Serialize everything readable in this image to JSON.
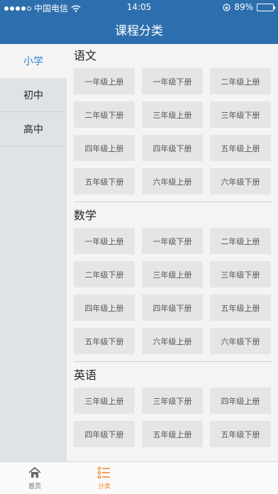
{
  "status_bar": {
    "carrier": "中国电信",
    "time": "14:05",
    "battery": "89%",
    "battery_level": 0.89
  },
  "header": {
    "title": "课程分类"
  },
  "sidebar": {
    "items": [
      {
        "label": "小学",
        "active": true
      },
      {
        "label": "初中",
        "active": false
      },
      {
        "label": "高中",
        "active": false
      }
    ]
  },
  "sections": [
    {
      "title": "语文",
      "items": [
        "一年级上册",
        "一年级下册",
        "二年级上册",
        "二年级下册",
        "三年级上册",
        "三年级下册",
        "四年级上册",
        "四年级下册",
        "五年级上册",
        "五年级下册",
        "六年级上册",
        "六年级下册"
      ]
    },
    {
      "title": "数学",
      "items": [
        "一年级上册",
        "一年级下册",
        "二年级上册",
        "二年级下册",
        "三年级上册",
        "三年级下册",
        "四年级上册",
        "四年级下册",
        "五年级上册",
        "五年级下册",
        "六年级上册",
        "六年级下册"
      ]
    },
    {
      "title": "英语",
      "items": [
        "三年级上册",
        "三年级下册",
        "四年级上册",
        "四年级下册",
        "五年级上册",
        "五年级下册"
      ]
    }
  ],
  "tabbar": {
    "tabs": [
      {
        "label": "首页",
        "icon": "home-icon",
        "active": false
      },
      {
        "label": "分类",
        "icon": "list-icon",
        "active": true
      }
    ]
  },
  "colors": {
    "primary": "#2d6fae",
    "active_tab": "#f08a2c",
    "sidebar_active_text": "#2d86d6"
  }
}
